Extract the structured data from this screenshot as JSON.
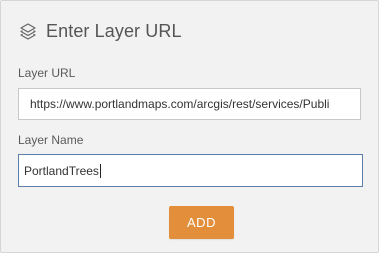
{
  "dialog": {
    "title": "Enter Layer URL",
    "icon": "layers-icon"
  },
  "form": {
    "url_label": "Layer URL",
    "url_value": "https://www.portlandmaps.com/arcgis/rest/services/Publi",
    "name_label": "Layer Name",
    "name_value": "PortlandTrees"
  },
  "actions": {
    "add_label": "ADD"
  },
  "colors": {
    "accent": "#e38e3a",
    "panel_bg": "#f2f2f2",
    "focus_border": "#5b7fa8"
  }
}
